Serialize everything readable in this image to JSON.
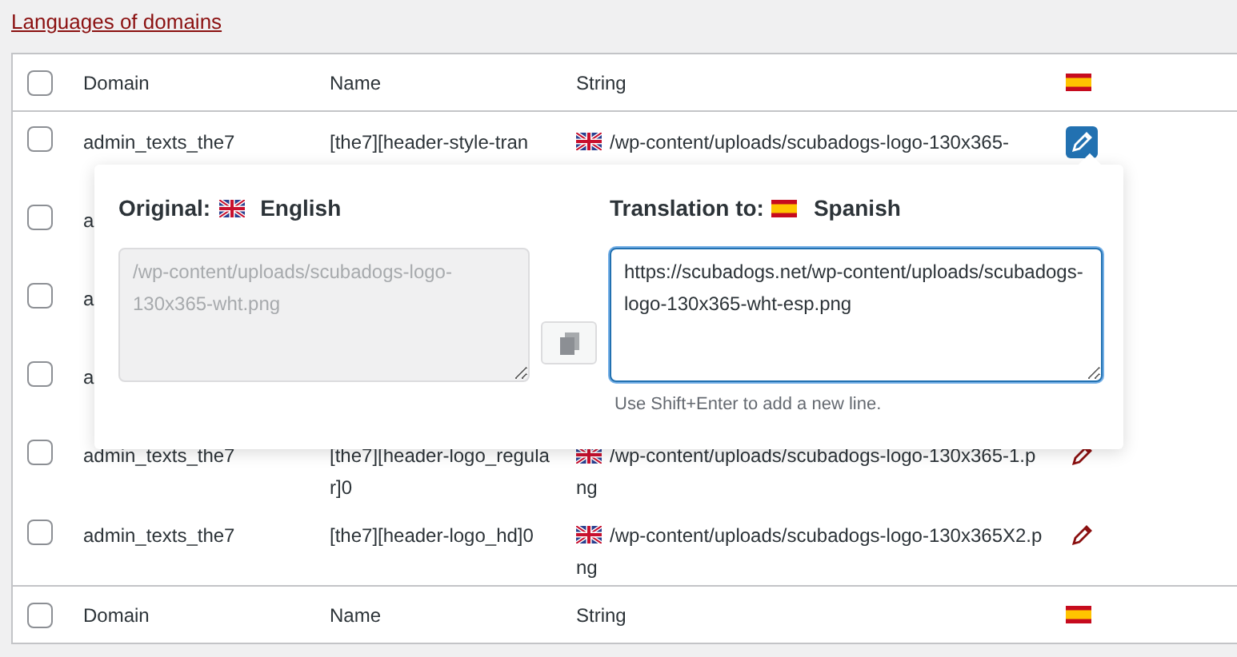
{
  "link": "Languages of domains",
  "table": {
    "select_all": false,
    "columns": [
      "Domain",
      "Name",
      "String"
    ],
    "footer_select_all": false,
    "footer_columns": [
      "Domain",
      "Name",
      "String"
    ],
    "rows": [
      {
        "checked": false,
        "domain": "admin_texts_the7",
        "name": "[the7][header-style-tran",
        "string": "/wp-content/uploads/scubadogs-logo-130x365-",
        "editing": true
      },
      {
        "checked": false,
        "domain": "a"
      },
      {
        "checked": false,
        "domain": "a"
      },
      {
        "checked": false,
        "domain": "a"
      },
      {
        "checked": false,
        "domain": "admin_texts_the7",
        "name": "[the7][header-logo_regular]0",
        "string": "/wp-content/uploads/scubadogs-logo-130x365-1.png",
        "editing": false
      },
      {
        "checked": false,
        "domain": "admin_texts_the7",
        "name": "[the7][header-logo_hd]0",
        "string": "/wp-content/uploads/scubadogs-logo-130x365X2.png",
        "editing": false
      }
    ]
  },
  "popup": {
    "original_label": "Original:",
    "original_language": "English",
    "translation_label": "Translation to:",
    "translation_language": "Spanish",
    "original_text": "/wp-content/uploads/scubadogs-logo-130x365-wht.png",
    "translation_text": "https://scubadogs.net/wp-content/uploads/scubadogs-logo-130x365-wht-esp.png",
    "hint": "Use Shift+Enter to add a new line."
  }
}
